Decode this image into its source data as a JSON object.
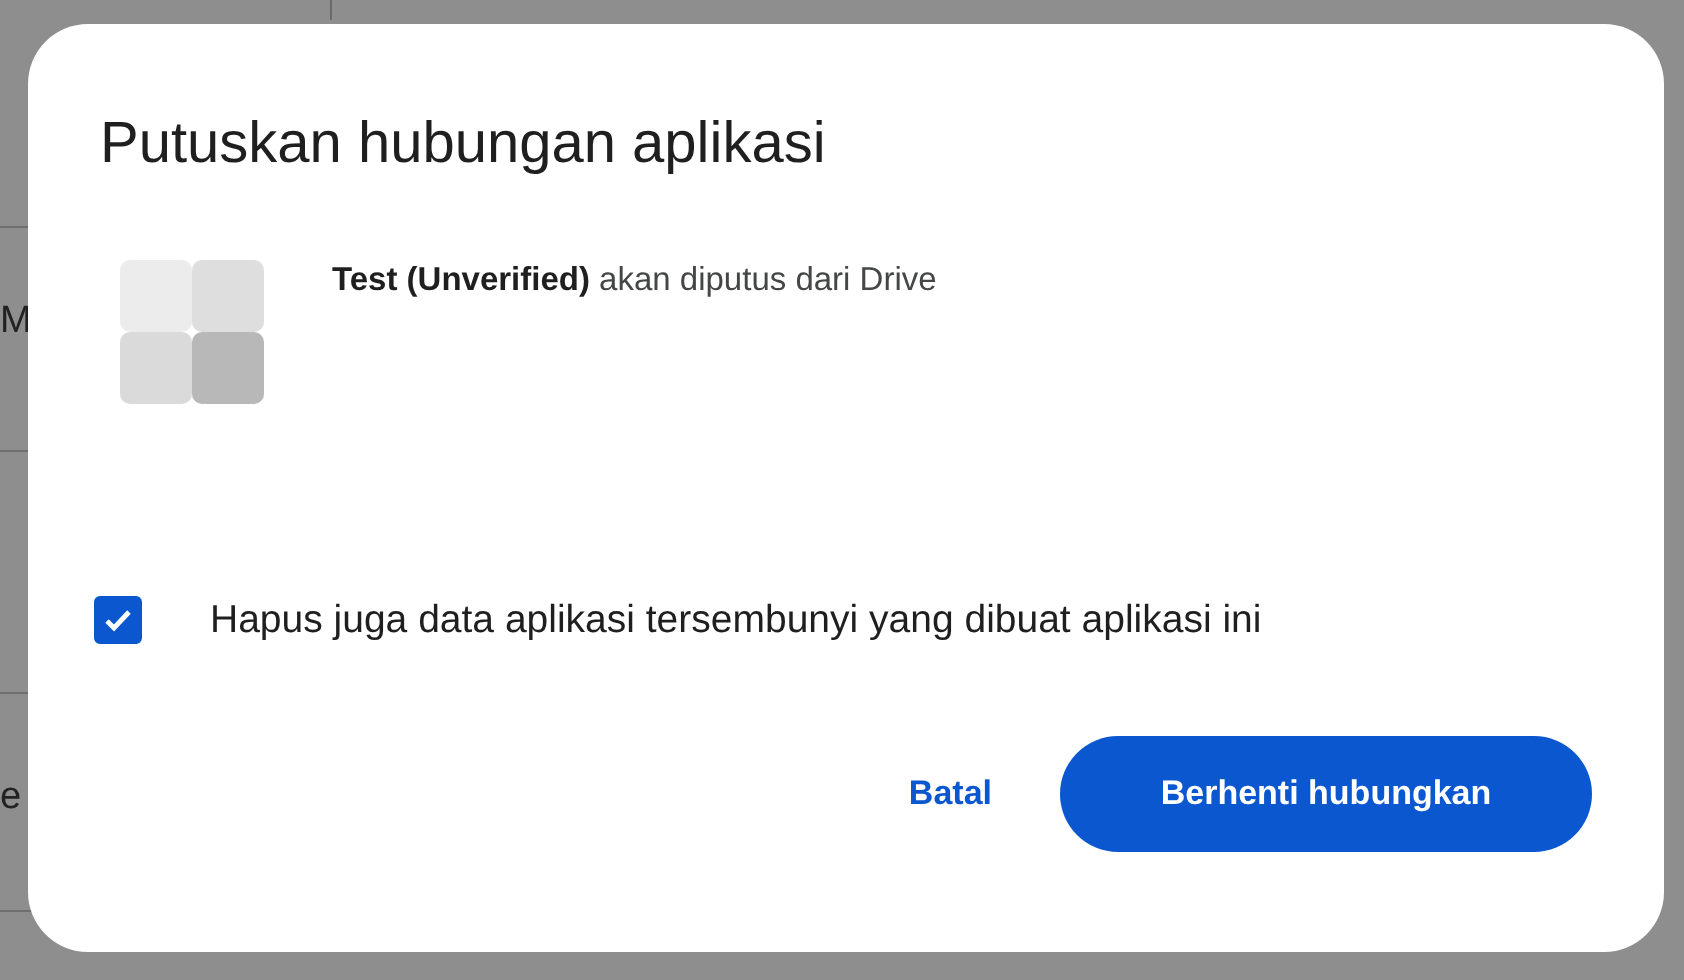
{
  "background": {
    "side_fragments": [
      "M",
      "e"
    ]
  },
  "dialog": {
    "title": "Putuskan hubungan aplikasi",
    "message": "**Test (Unverified)** akan diputus dari Drive",
    "checkbox": {
      "label": "Hapus juga data aplikasi tersembunyi yang dibuat aplikasi ini",
      "checked": true
    },
    "buttons": [
      {
        "label": "Batal",
        "kind": "text"
      },
      {
        "label": "Berhenti hubungkan",
        "kind": "filled"
      }
    ]
  }
}
